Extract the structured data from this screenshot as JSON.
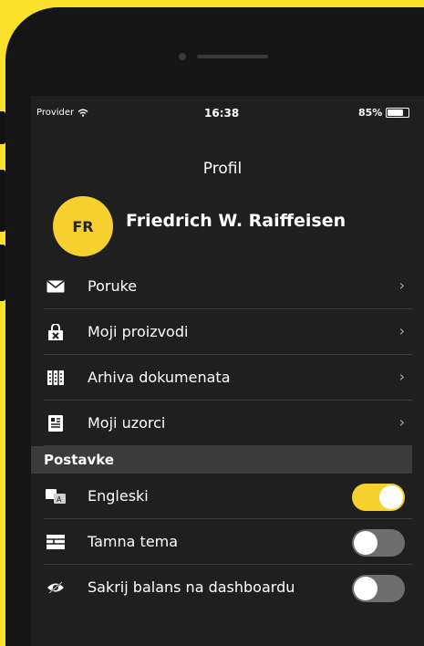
{
  "status_bar": {
    "provider": "Provider",
    "time": "16:38",
    "battery": "85%",
    "battery_level": 0.85
  },
  "header": {
    "title": "Profil"
  },
  "profile": {
    "initials": "FR",
    "name": "Friedrich W. Raiffeisen"
  },
  "menu": [
    {
      "label": "Poruke",
      "icon": "envelope-icon"
    },
    {
      "label": "Moji proizvodi",
      "icon": "lock-bag-icon"
    },
    {
      "label": "Arhiva dokumenata",
      "icon": "archive-icon"
    },
    {
      "label": "Moji uzorci",
      "icon": "templates-icon"
    }
  ],
  "settings": {
    "title": "Postavke",
    "items": [
      {
        "label": "Engleski",
        "icon": "translate-icon",
        "enabled": true
      },
      {
        "label": "Tamna tema",
        "icon": "theme-icon",
        "enabled": false
      },
      {
        "label": "Sakrij balans na dashboardu",
        "icon": "hide-eye-icon",
        "enabled": false
      }
    ]
  },
  "colors": {
    "accent": "#f5d02e",
    "background": "#fbe22a",
    "screen": "#1f1f1f"
  }
}
